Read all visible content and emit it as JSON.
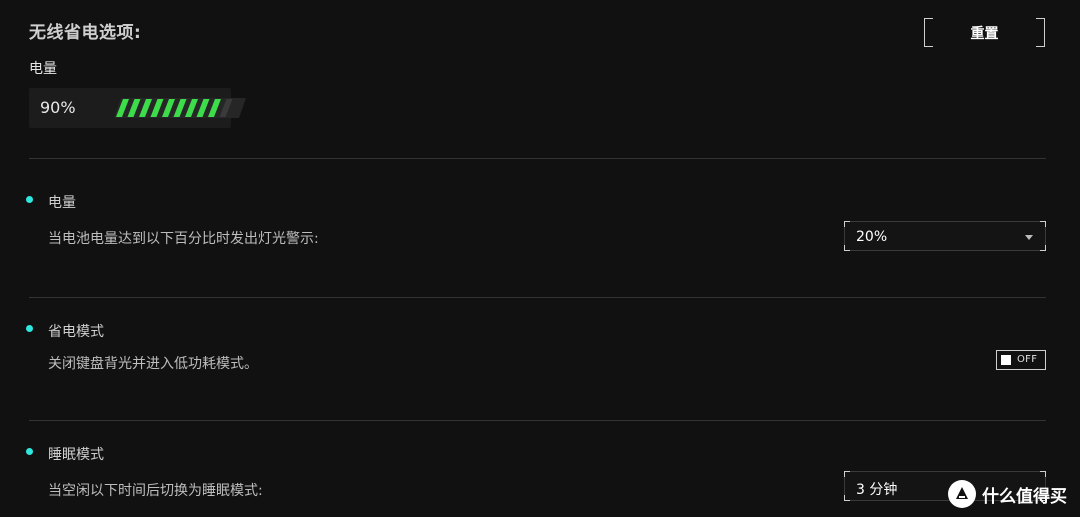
{
  "header": {
    "title": "无线省电选项:",
    "reset_label": "重置"
  },
  "battery": {
    "label": "电量",
    "percent_text": "90%",
    "level": 0.9,
    "segments_total": 10,
    "bar_color": "#3ddc4a",
    "bar_empty_color": "#3a3a3a"
  },
  "sections": {
    "battery_alert": {
      "heading": "电量",
      "description": "当电池电量达到以下百分比时发出灯光警示:",
      "selected": "20%"
    },
    "power_save": {
      "heading": "省电模式",
      "description": "关闭键盘背光并进入低功耗模式。",
      "toggle_state": "OFF"
    },
    "sleep": {
      "heading": "睡眠模式",
      "description": "当空闲以下时间后切换为睡眠模式:",
      "selected": "3 分钟"
    }
  },
  "watermark": {
    "text": "什么值得买",
    "logo_glyph": "值"
  },
  "colors": {
    "accent_bullet": "#2ee8e0",
    "background": "#111111"
  }
}
